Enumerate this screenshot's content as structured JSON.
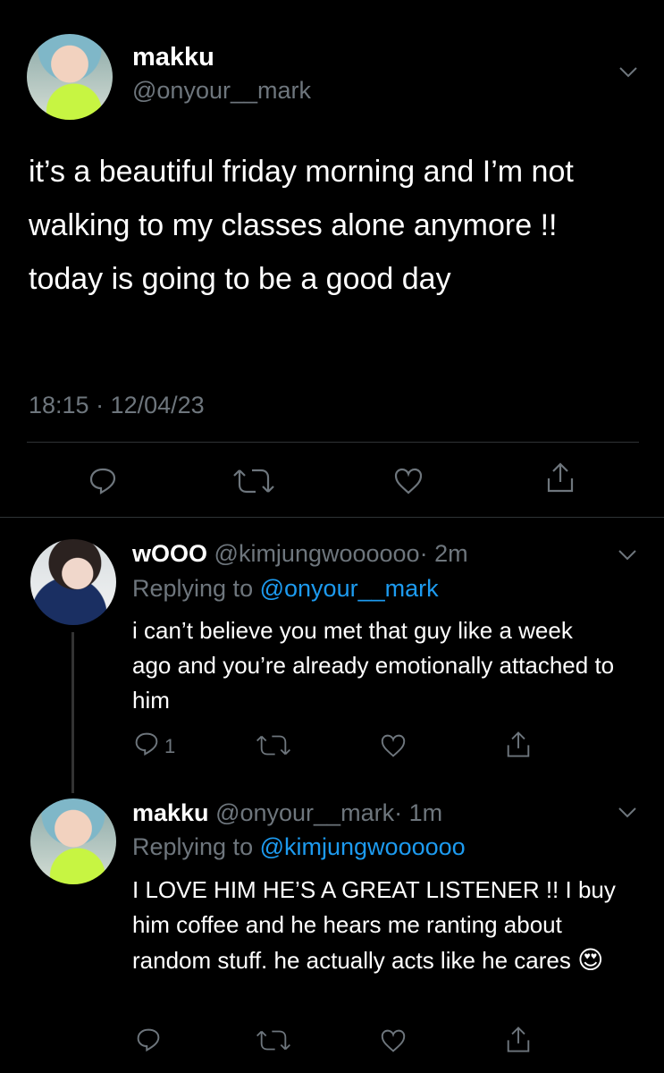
{
  "main_tweet": {
    "display_name": "makku",
    "handle": "@onyour__mark",
    "text": "it’s a beautiful friday morning and I’m not walking to my classes alone anymore !! today is going to be a good day",
    "timestamp": "18:15 · 12/04/23"
  },
  "replies": [
    {
      "display_name": "wOOO",
      "handle": "@kimjungwoooooo",
      "time": "· 2m",
      "replying_label": "Replying to",
      "replying_to": "@onyour__mark",
      "text": "i can’t believe you met that guy like a week ago and you’re already emotionally attached to him",
      "reply_count": "1"
    },
    {
      "display_name": "makku",
      "handle": "@onyour__mark",
      "time": "· 1m",
      "replying_label": "Replying to",
      "replying_to": "@kimjungwoooooo",
      "text": "I LOVE HIM HE’S A GREAT LISTENER !! I buy him coffee and he hears me ranting about random stuff. he actually acts like he cares",
      "emoji": "😍"
    }
  ],
  "colors": {
    "background": "#000000",
    "muted": "#6e767d",
    "link": "#1d9bf0",
    "divider": "#2f3336"
  }
}
